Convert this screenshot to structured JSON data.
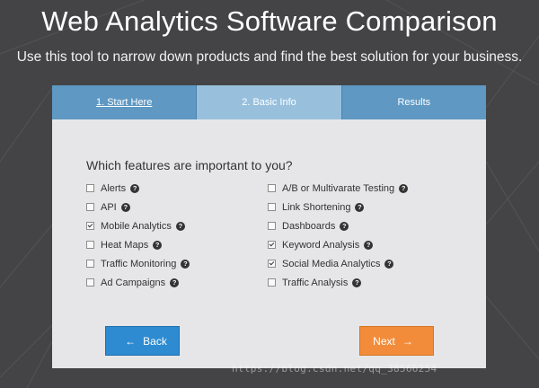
{
  "header": {
    "title": "Web Analytics Software Comparison",
    "subtitle": "Use this tool to narrow down products and find the best solution for your business."
  },
  "tabs": [
    {
      "label": "1. Start Here",
      "active": false
    },
    {
      "label": "2. Basic Info",
      "active": true
    },
    {
      "label": "Results",
      "active": false
    }
  ],
  "question": "Which features are important to you?",
  "features_left": [
    {
      "label": "Alerts",
      "checked": false
    },
    {
      "label": "API",
      "checked": false
    },
    {
      "label": "Mobile Analytics",
      "checked": true
    },
    {
      "label": "Heat Maps",
      "checked": false
    },
    {
      "label": "Traffic Monitoring",
      "checked": false
    },
    {
      "label": "Ad Campaigns",
      "checked": false
    }
  ],
  "features_right": [
    {
      "label": "A/B or Multivarate Testing",
      "checked": false
    },
    {
      "label": "Link Shortening",
      "checked": false
    },
    {
      "label": "Dashboards",
      "checked": false
    },
    {
      "label": "Keyword Analysis",
      "checked": true
    },
    {
      "label": "Social Media Analytics",
      "checked": true
    },
    {
      "label": "Traffic Analysis",
      "checked": false
    }
  ],
  "help_glyph": "?",
  "buttons": {
    "back_label": "Back",
    "back_arrow": "←",
    "next_label": "Next",
    "next_arrow": "→"
  },
  "watermark": "https://blog.csdn.net/qq_38566254",
  "colors": {
    "background": "#444446",
    "tab": "#5e98c3",
    "tab_active": "#98c0dd",
    "card": "#e6e6e8",
    "back_button": "#2e8bd1",
    "next_button": "#f28c3a"
  }
}
